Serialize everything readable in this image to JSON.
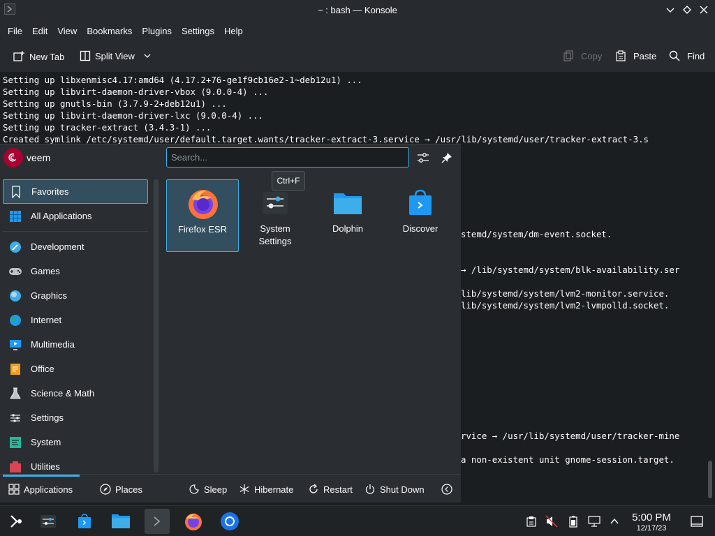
{
  "window": {
    "title": "~ : bash — Konsole"
  },
  "menubar": [
    "File",
    "Edit",
    "View",
    "Bookmarks",
    "Plugins",
    "Settings",
    "Help"
  ],
  "toolbar": {
    "new_tab": "New Tab",
    "split_view": "Split View",
    "copy": "Copy",
    "paste": "Paste",
    "find": "Find"
  },
  "terminal": {
    "lines": [
      "Setting up libxenmisc4.17:amd64 (4.17.2+76-ge1f9cb16e2-1~deb12u1) ...",
      "Setting up libvirt-daemon-driver-vbox (9.0.0-4) ...",
      "Setting up gnutls-bin (3.7.9-2+deb12u1) ...",
      "Setting up libvirt-daemon-driver-lxc (9.0.0-4) ...",
      "Setting up tracker-extract (3.4.3-1) ...",
      "Created symlink /etc/systemd/user/default.target.wants/tracker-extract-3.service → /usr/lib/systemd/user/tracker-extract-3.s",
      "stemd/system/dm-event.socket.",
      "→ /lib/systemd/system/blk-availability.ser",
      "lib/systemd/system/lvm2-monitor.service.",
      "lib/systemd/system/lvm2-lvmpolld.socket.",
      "rvice → /usr/lib/systemd/user/tracker-mine",
      "a non-existent unit gnome-session.target."
    ]
  },
  "launcher": {
    "user": "veem",
    "search_placeholder": "Search...",
    "tooltip": "Ctrl+F",
    "categories": [
      "Favorites",
      "All Applications",
      "Development",
      "Games",
      "Graphics",
      "Internet",
      "Multimedia",
      "Office",
      "Science & Math",
      "Settings",
      "System",
      "Utilities"
    ],
    "apps": [
      {
        "label": "Firefox ESR",
        "icon": "firefox-icon"
      },
      {
        "label": "System Settings",
        "icon": "system-settings-icon"
      },
      {
        "label": "Dolphin",
        "icon": "folder-icon"
      },
      {
        "label": "Discover",
        "icon": "store-icon"
      }
    ],
    "footer": {
      "applications": "Applications",
      "places": "Places",
      "sleep": "Sleep",
      "hibernate": "Hibernate",
      "restart": "Restart",
      "shutdown": "Shut Down"
    }
  },
  "taskbar": {
    "time": "5:00 PM",
    "date": "12/17/23"
  },
  "colors": {
    "accent": "#3daee9",
    "selection": "#334e5e",
    "panel": "#2a2e32",
    "terminal_bg": "#1b1e20"
  }
}
